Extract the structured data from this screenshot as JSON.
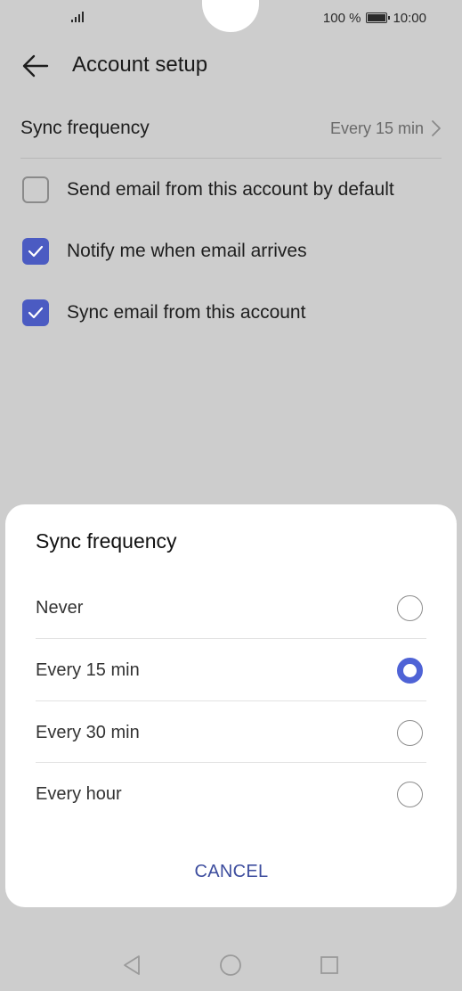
{
  "status_bar": {
    "battery_percent": "100 %",
    "time": "10:00"
  },
  "header": {
    "title": "Account setup"
  },
  "settings": {
    "sync_frequency": {
      "label": "Sync frequency",
      "value": "Every 15 min"
    },
    "checkboxes": [
      {
        "label": "Send email from this account by default",
        "checked": false
      },
      {
        "label": "Notify me when email arrives",
        "checked": true
      },
      {
        "label": "Sync email from this account",
        "checked": true
      }
    ]
  },
  "dialog": {
    "title": "Sync frequency",
    "options": [
      {
        "label": "Never",
        "selected": false
      },
      {
        "label": "Every 15 min",
        "selected": true
      },
      {
        "label": "Every 30 min",
        "selected": false
      },
      {
        "label": "Every hour",
        "selected": false
      }
    ],
    "cancel_label": "CANCEL"
  },
  "colors": {
    "accent": "#4f63d6",
    "checkbox_checked": "#4b5bc2",
    "cancel_text": "#3d4d9e",
    "scrim_background": "#cdcdcd"
  },
  "icons": {
    "back": "arrow-left-icon",
    "chevron": "chevron-right-icon",
    "check": "check-icon",
    "nav_back": "triangle-back-icon",
    "nav_home": "circle-home-icon",
    "nav_recents": "square-recents-icon",
    "signal": "signal-icon",
    "battery": "battery-icon"
  }
}
